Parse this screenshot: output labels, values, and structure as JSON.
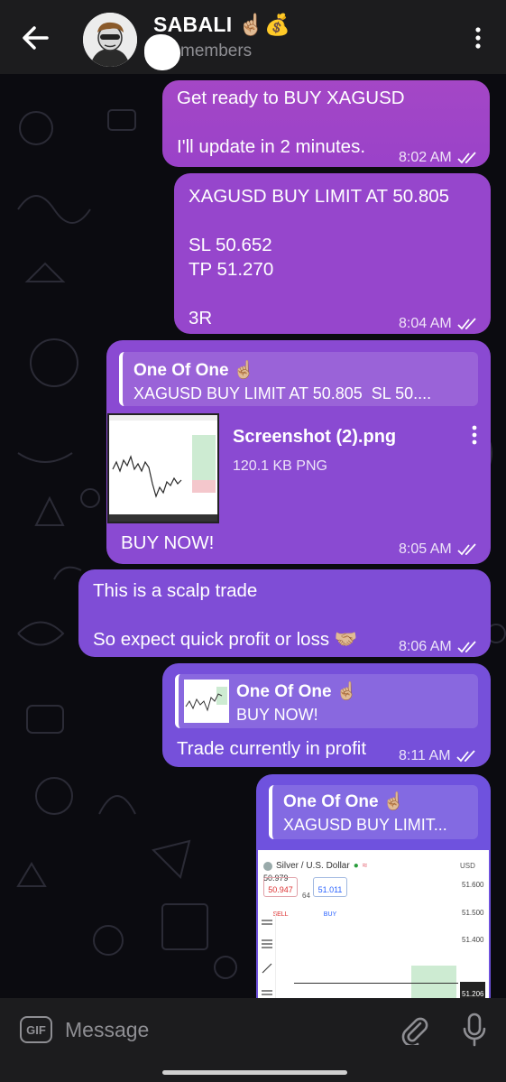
{
  "header": {
    "title": "SABALI ☝🏼💰",
    "subtitle": "members",
    "back_icon": "arrow-left-icon",
    "menu_icon": "more-vert-icon"
  },
  "messages": [
    {
      "lines": [
        "Get ready to BUY XAGUSD",
        "",
        "I'll update in 2 minutes."
      ],
      "time": "8:02 AM"
    },
    {
      "lines": [
        "XAGUSD BUY LIMIT AT 50.805",
        "",
        "SL 50.652",
        "TP 51.270",
        "",
        "3R"
      ],
      "time": "8:04 AM"
    },
    {
      "reply_name": "One Of One ☝🏼",
      "reply_text": "XAGUSD BUY LIMIT AT 50.805  SL 50....",
      "file_name": "Screenshot (2).png",
      "file_meta": "120.1 KB PNG",
      "text": "BUY NOW!",
      "time": "8:05 AM"
    },
    {
      "lines": [
        "This is a scalp trade",
        "",
        "So expect quick profit or loss 🤝🏼"
      ],
      "time": "8:06 AM"
    },
    {
      "reply_name": "One Of One ☝🏼",
      "reply_text": "BUY NOW!",
      "text": "Trade currently in profit",
      "time": "8:11 AM"
    },
    {
      "reply_name": "One Of One ☝🏼",
      "reply_text": "XAGUSD BUY LIMIT...",
      "chart": {
        "title": "Silver / U.S. Dollar",
        "price": "50.979",
        "sell": "50.947",
        "sell_label": "SELL",
        "spread": "64",
        "buy": "51.011",
        "buy_label": "BUY",
        "currency": "USD",
        "axis": [
          "51.600",
          "51.500",
          "51.400",
          "51.206"
        ]
      }
    }
  ],
  "composer": {
    "gif_label": "GIF",
    "placeholder": "Message",
    "attach_icon": "paperclip-icon",
    "mic_icon": "microphone-icon"
  },
  "colors": {
    "header_bg": "#1c1c1e",
    "bubble_top": "#a447c6",
    "bubble_bottom": "#6f52de"
  }
}
